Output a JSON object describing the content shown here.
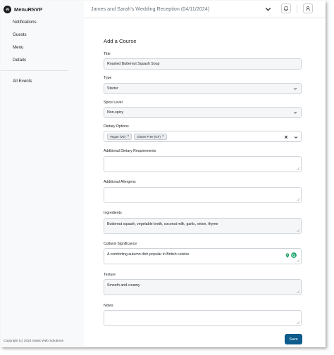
{
  "app": {
    "name": "MenuRSVP"
  },
  "sidebar": {
    "items": [
      {
        "label": "Notifications"
      },
      {
        "label": "Guests"
      },
      {
        "label": "Menu"
      },
      {
        "label": "Details"
      }
    ],
    "secondary": [
      {
        "label": "All Events"
      }
    ],
    "copyright": "Copyright (c) 2024 Salus Web Solutions"
  },
  "header": {
    "event_title": "James and Sarah's Wedding Reception (04/11/2024)"
  },
  "icons": {
    "brand": "menu-logo-icon",
    "dropdown": "chevron-down-icon",
    "notifications": "bell-icon",
    "user": "user-icon"
  },
  "form": {
    "heading": "Add a Course",
    "title": {
      "label": "Title",
      "value": "Roasted Butternut Squash Soup"
    },
    "type": {
      "label": "Type",
      "value": "Starter"
    },
    "spice": {
      "label": "Spice Level",
      "value": "Non-spicy"
    },
    "dietary": {
      "label": "Dietary Options",
      "chips": [
        "Vegan (VE)",
        "Gluten Free (GF)"
      ]
    },
    "additional_dietary": {
      "label": "Additional Dietary Requirements",
      "value": ""
    },
    "additional_allergens": {
      "label": "Additional Allergens",
      "value": ""
    },
    "ingredients": {
      "label": "Ingredients",
      "value": "Butternut squash, vegetable broth, coconut milk, garlic, onion, thyme"
    },
    "cultural": {
      "label": "Cultural Significance",
      "value": "A comforting autumn dish popular in British cuisine."
    },
    "texture": {
      "label": "Texture",
      "value": "Smooth and creamy"
    },
    "notes": {
      "label": "Notes",
      "value": ""
    },
    "save_label": "Save"
  },
  "colors": {
    "primary": "#0d5c8c",
    "sidebar_bg": "#f8f9fa",
    "accent_green": "#2aa06a"
  }
}
